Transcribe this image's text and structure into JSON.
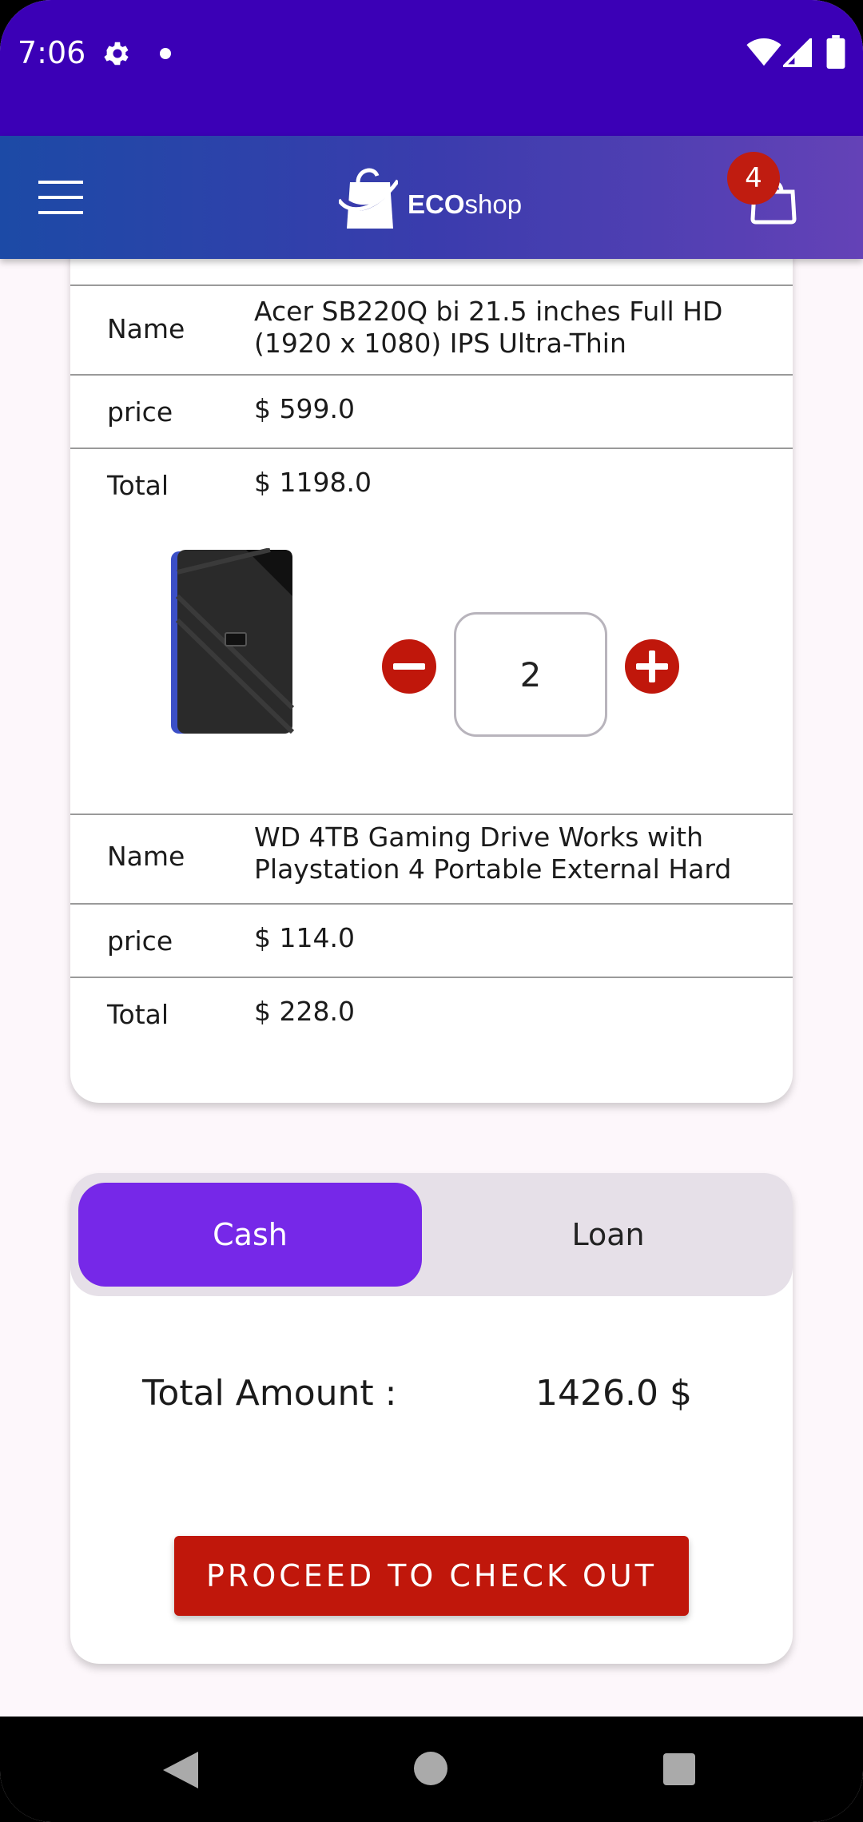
{
  "status_bar": {
    "time": "7:06",
    "icons": [
      "gear-icon",
      "dot-icon",
      "wifi-icon",
      "signal-icon",
      "battery-icon"
    ]
  },
  "app_bar": {
    "logo_bold": "ECO",
    "logo_light": "shop",
    "cart_count": "4",
    "gradient_colors": [
      "#1c4aa6",
      "#6442b7"
    ]
  },
  "products": [
    {
      "name_label": "Name",
      "name": "Acer SB220Q bi 21.5 inches Full HD (1920 x 1080) IPS Ultra-Thin",
      "price_label": "price",
      "price": "$ 599.0",
      "total_label": "Total",
      "total": "$ 1198.0"
    },
    {
      "image": "wd-external-hard-drive",
      "quantity": "2",
      "name_label": "Name",
      "name": "WD 4TB Gaming Drive Works with Playstation 4 Portable External Hard",
      "price_label": "price",
      "price": "$ 114.0",
      "total_label": "Total",
      "total": "$ 228.0"
    }
  ],
  "payment": {
    "options": [
      "Cash",
      "Loan"
    ],
    "selected": "Cash",
    "total_label": "Total Amount :",
    "total_value": "1426.0 $",
    "checkout_label": "PROCEED TO CHECK OUT"
  },
  "colors": {
    "status_bar": "#3b00b6",
    "accent_red": "#c0170b",
    "toggle_selected": "#7628e8",
    "toggle_track": "#e6e0e8"
  }
}
